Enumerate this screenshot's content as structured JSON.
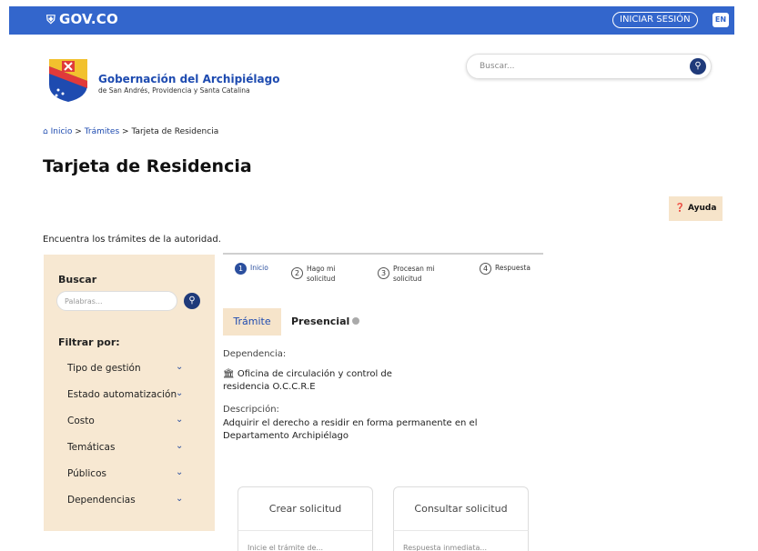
{
  "topbar": {
    "logo_text": "GOV.CO",
    "login_label": "INICIAR SESIÓN",
    "lang_label": "EN",
    "color": "#3366cc"
  },
  "header": {
    "org_title": "Gobernación del Archipiélago",
    "org_subtitle": "de San Andrés, Providencia y Santa Catalina",
    "search_placeholder": "Buscar..."
  },
  "breadcrumb": {
    "home": "Inicio",
    "sep": ">",
    "tramites": "Trámites",
    "current": "Tarjeta de Residencia"
  },
  "page_title": "Tarjeta de Residencia",
  "help_label": "Ayuda",
  "intro_text": "Encuentra los trámites de la autoridad.",
  "filters": {
    "search_label": "Buscar",
    "keyword_placeholder": "Palabras...",
    "filter_title": "Filtrar por:",
    "items": [
      {
        "label": "Tipo de gestión"
      },
      {
        "label": "Estado automatización"
      },
      {
        "label": "Costo"
      },
      {
        "label": "Temáticas"
      },
      {
        "label": "Públicos"
      },
      {
        "label": "Dependencias"
      }
    ]
  },
  "steps": [
    {
      "num": "1",
      "label": "Inicio",
      "active": true
    },
    {
      "num": "2",
      "line1": "Hago mi",
      "line2": "solicitud"
    },
    {
      "num": "3",
      "line1": "Procesan mi",
      "line2": "solicitud"
    },
    {
      "num": "4",
      "label": "Respuesta"
    }
  ],
  "tabs": {
    "tramite": "Trámite",
    "presencial": "Presencial"
  },
  "detail": {
    "dependencia_label": "Dependencia:",
    "dependencia_line1": "Oficina de circulación y control de",
    "dependencia_line2": "residencia O.C.C.R.E",
    "descripcion_label": "Descripción:",
    "descripcion_line1": "Adquirir el derecho a residir en forma permanente en el",
    "descripcion_line2": "Departamento Archipiélago"
  },
  "cards": {
    "crear": "Crear solicitud",
    "crear_sub": "Inicie el trámite de...",
    "consultar": "Consultar solicitud",
    "consultar_sub": "Respuesta inmediata..."
  }
}
